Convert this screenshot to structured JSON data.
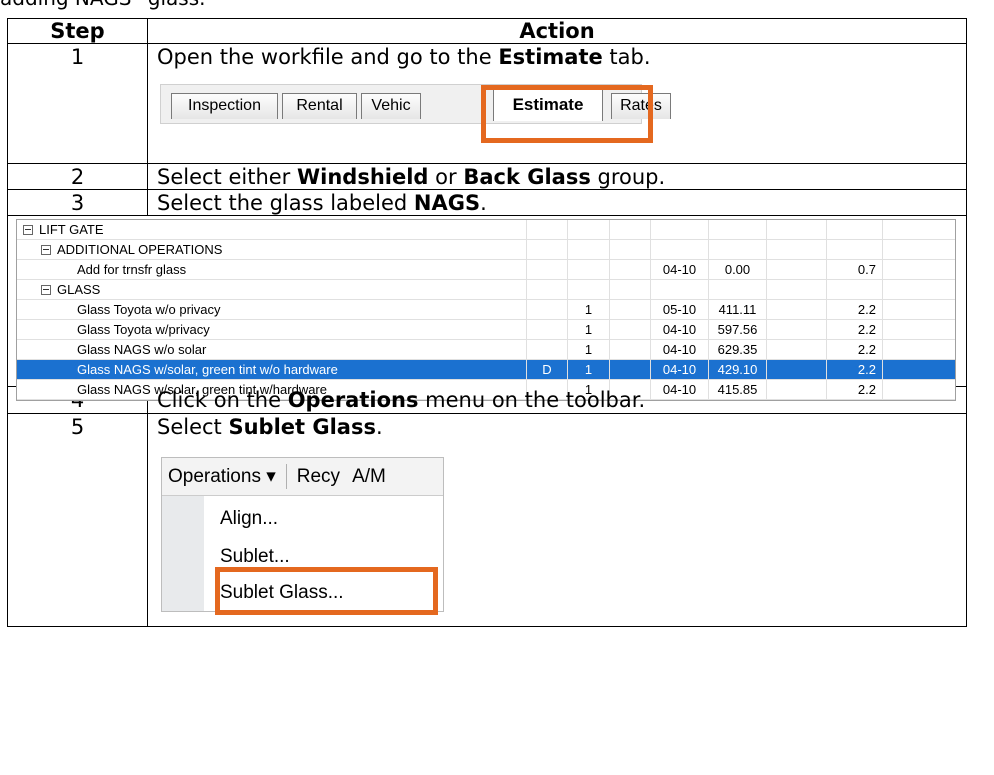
{
  "top_caption": "adding NAGS* glass.",
  "headers": {
    "step": "Step",
    "action": "Action"
  },
  "steps": [
    {
      "num": "1",
      "pre": "Open the workfile and go to the ",
      "bold": "Estimate",
      "post": " tab."
    },
    {
      "num": "2",
      "pre": "Select either ",
      "bold": "Windshield",
      "mid": " or ",
      "bold2": "Back Glass",
      "post": " group."
    },
    {
      "num": "3",
      "pre": "Select the glass labeled ",
      "bold": "NAGS",
      "post": "."
    },
    {
      "num": "4",
      "pre": "Click on the ",
      "bold": "Operations",
      "post": " menu on the toolbar."
    },
    {
      "num": "5",
      "pre": "Select ",
      "bold": "Sublet Glass",
      "post": "."
    }
  ],
  "tabs": [
    "Inspection",
    "Rental",
    "Vehic",
    "Estimate",
    "Rates"
  ],
  "grid": {
    "rows": [
      {
        "desc": "LIFT GATE",
        "expander": true,
        "indent": 0
      },
      {
        "desc": "ADDITIONAL OPERATIONS",
        "expander": true,
        "indent": 1
      },
      {
        "desc": "Add for trnsfr glass",
        "indent": 2,
        "flag": "",
        "qty": "",
        "date": "04-10",
        "price": "0.00",
        "hours": "0.7"
      },
      {
        "desc": "GLASS",
        "expander": true,
        "indent": 1
      },
      {
        "desc": "Glass Toyota w/o privacy",
        "indent": 2,
        "flag": "",
        "qty": "1",
        "date": "05-10",
        "price": "411.11",
        "hours": "2.2"
      },
      {
        "desc": "Glass Toyota w/privacy",
        "indent": 2,
        "flag": "",
        "qty": "1",
        "date": "04-10",
        "price": "597.56",
        "hours": "2.2"
      },
      {
        "desc": "Glass NAGS w/o solar",
        "indent": 2,
        "flag": "",
        "qty": "1",
        "date": "04-10",
        "price": "629.35",
        "hours": "2.2"
      },
      {
        "desc": "Glass NAGS w/solar, green tint w/o hardware",
        "indent": 2,
        "flag": "D",
        "qty": "1",
        "date": "04-10",
        "price": "429.10",
        "hours": "2.2",
        "selected": true
      },
      {
        "desc": "Glass NAGS w/solar, green tint w/hardware",
        "indent": 2,
        "flag": "",
        "qty": "1",
        "date": "04-10",
        "price": "415.85",
        "hours": "2.2"
      }
    ]
  },
  "menu": {
    "bar": [
      "Operations ▾",
      "Recy",
      "A/M"
    ],
    "items": [
      "Align...",
      "Sublet...",
      "Sublet Glass..."
    ]
  },
  "colors": {
    "highlight": "#e4681f",
    "selection": "#1b71d0"
  }
}
